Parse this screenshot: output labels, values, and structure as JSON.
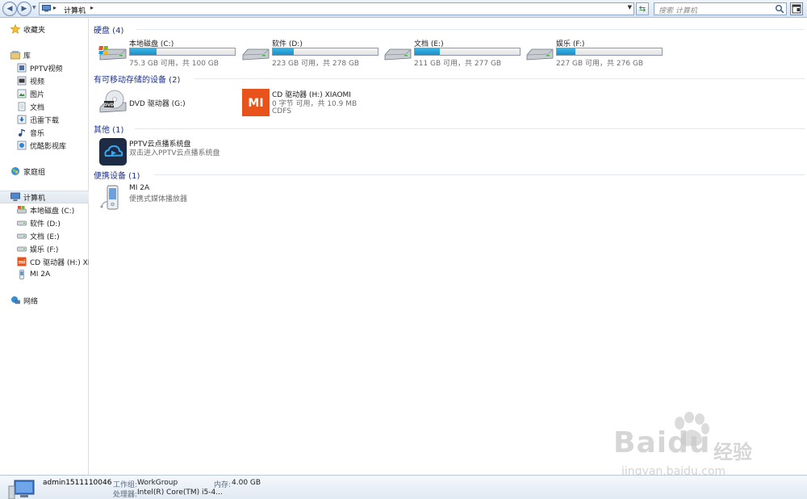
{
  "address": {
    "path": "计算机",
    "search_placeholder": "搜索 计算机"
  },
  "nav": {
    "favorites": "收藏夹",
    "libraries": "库",
    "library_items": [
      "PPTV视频",
      "视频",
      "图片",
      "文档",
      "迅雷下载",
      "音乐",
      "优酷影视库"
    ],
    "homegroup": "家庭组",
    "computer": "计算机",
    "computer_items": [
      "本地磁盘 (C:)",
      "软件 (D:)",
      "文档 (E:)",
      "娱乐 (F:)",
      "CD 驱动器 (H:) XIAOMI",
      "MI 2A"
    ],
    "network": "网络"
  },
  "groups": {
    "hdd": "硬盘 (4)",
    "removable": "有可移动存储的设备 (2)",
    "other": "其他 (1)",
    "portable": "便携设备 (1)"
  },
  "drives": [
    {
      "name": "本地磁盘 (C:)",
      "free": "75.3 GB 可用，共 100 GB",
      "used_fraction": 0.25
    },
    {
      "name": "软件 (D:)",
      "free": "223 GB 可用，共 278 GB",
      "used_fraction": 0.2
    },
    {
      "name": "文档 (E:)",
      "free": "211 GB 可用，共 277 GB",
      "used_fraction": 0.24
    },
    {
      "name": "娱乐 (F:)",
      "free": "227 GB 可用，共 276 GB",
      "used_fraction": 0.18
    }
  ],
  "removable_devices": [
    {
      "name": "DVD 驱动器 (G:)"
    },
    {
      "name": "CD 驱动器 (H:) XIAOMI",
      "free": "0 字节 可用，共 10.9 MB",
      "fs": "CDFS",
      "logo": "MI"
    }
  ],
  "other_items": [
    {
      "name": "PPTV云点播系统盘",
      "desc": "双击进入PPTV云点播系统盘"
    }
  ],
  "portable_devices": [
    {
      "name": "MI 2A",
      "desc": "便携式媒体播放器"
    }
  ],
  "details": {
    "computer_name": "admin1511110046",
    "workgroup_label": "工作组:",
    "workgroup": "WorkGroup",
    "memory_label": "内存:",
    "memory": "4.00 GB",
    "cpu_label": "处理器:",
    "cpu": "Intel(R) Core(TM) i5-4..."
  },
  "watermark": {
    "brand": "Baidu",
    "cn": "经验",
    "url": "jingyan.baidu.com"
  },
  "colors": {
    "group_title": "#1e3287",
    "bar_fill": "#26a0d6",
    "xiaomi_orange": "#e8531b"
  }
}
